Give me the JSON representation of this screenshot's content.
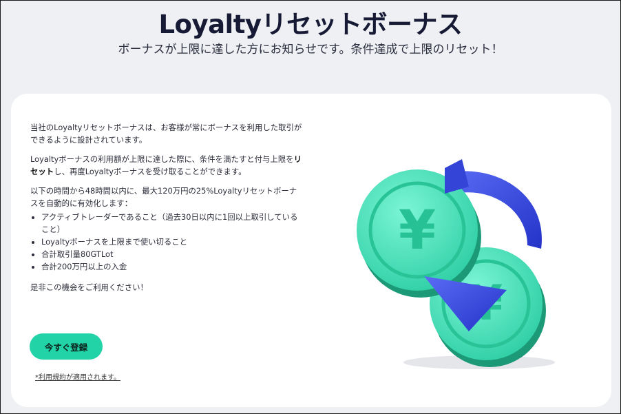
{
  "header": {
    "title": "Loyaltyリセットボーナス",
    "subtitle": "ボーナスが上限に達した方にお知らせです。条件達成で上限のリセット！"
  },
  "content": {
    "para1": "当社のLoyaltyリセットボーナスは、お客様が常にボーナスを利用した取引ができるように設計されています。",
    "para2_before": "Loyaltyボーナスの利用額が上限に達した際に、条件を満たすと付与上限を",
    "para2_bold": "リセット",
    "para2_after": "し、再度Loyaltyボーナスを受け取ることができます。",
    "para3": "以下の時間から48時間以内に、最大120万円の25%Loyaltyリセットボーナスを自動的に有効化します：",
    "conditions": [
      "アクティブトレーダーであること（過去30日以内に1回以上取引していること）",
      "Loyaltyボーナスを上限まで使い切ること",
      "合計取引量80GTLot",
      "合計200万円以上の入金"
    ],
    "closing": "是非この機会をご利用ください！",
    "cta_label": "今すぐ登録",
    "terms_link": "*利用規約が適用されます。"
  },
  "colors": {
    "accent": "#21d3a6",
    "coin": "#3fe6bd",
    "arrow": "#3b4fe0"
  },
  "illustration": {
    "icon_names": [
      "yen-coin-icon",
      "yen-coin-icon",
      "refresh-arrows-icon"
    ]
  }
}
